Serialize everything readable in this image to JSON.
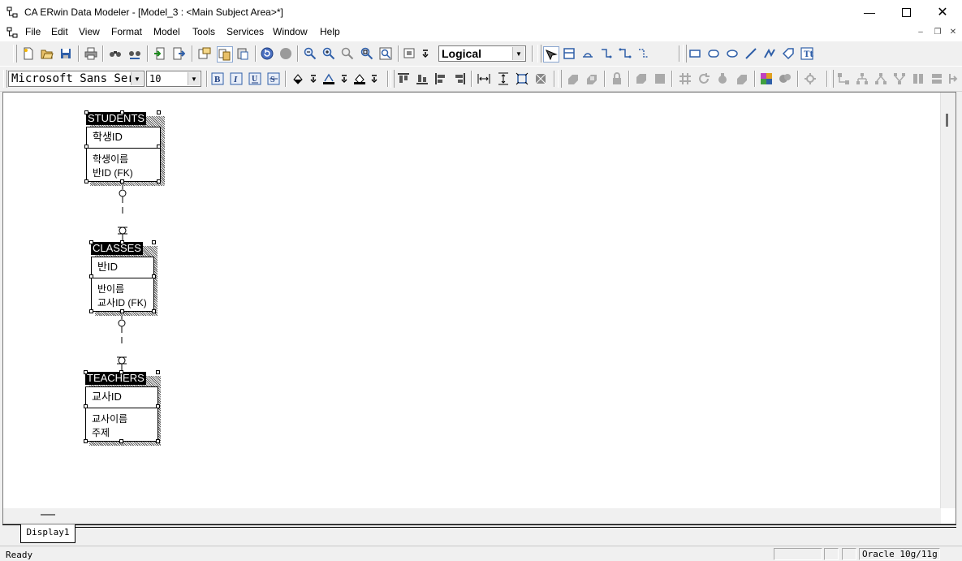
{
  "window": {
    "title": "CA ERwin Data Modeler - [Model_3 : <Main Subject Area>*]"
  },
  "menu": [
    "File",
    "Edit",
    "View",
    "Format",
    "Model",
    "Tools",
    "Services",
    "Window",
    "Help"
  ],
  "toolbar": {
    "view_mode": "Logical",
    "font_name": "Microsoft Sans Serif",
    "font_size": "10"
  },
  "entities": [
    {
      "name": "STUDENTS",
      "key": "학생ID",
      "attrs": [
        "학생이름",
        "반ID (FK)"
      ]
    },
    {
      "name": "CLASSES",
      "key": "반ID",
      "attrs": [
        "반이름",
        "교사ID (FK)"
      ]
    },
    {
      "name": "TEACHERS",
      "key": "교사ID",
      "attrs": [
        "교사이름",
        "주제"
      ]
    }
  ],
  "tabs": [
    "Display1"
  ],
  "status": {
    "text": "Ready",
    "database": "Oracle 10g/11g"
  }
}
